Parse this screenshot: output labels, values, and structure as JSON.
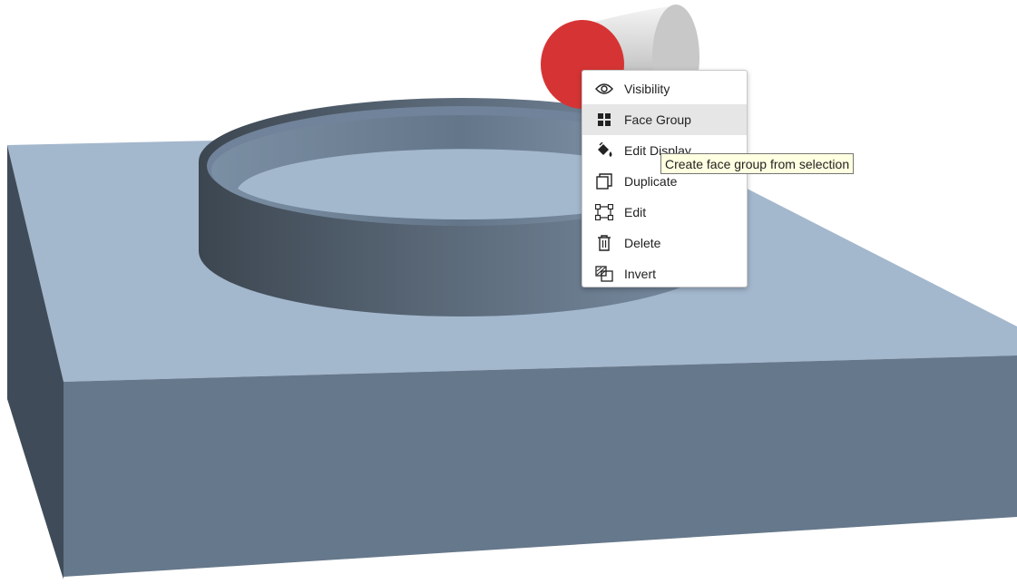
{
  "context_menu": {
    "items": [
      {
        "label": "Visibility",
        "icon": "eye-icon"
      },
      {
        "label": "Face Group",
        "icon": "grid-icon"
      },
      {
        "label": "Edit Display",
        "icon": "paint-bucket-icon"
      },
      {
        "label": "Duplicate",
        "icon": "duplicate-icon"
      },
      {
        "label": "Edit",
        "icon": "edit-frame-icon"
      },
      {
        "label": "Delete",
        "icon": "trash-icon"
      },
      {
        "label": "Invert",
        "icon": "invert-icon"
      }
    ],
    "hovered_item": "Face Group"
  },
  "tooltip": {
    "text": "Create face group from selection"
  },
  "colors": {
    "highlighted_face": "#d63434",
    "model_top": "#a3b7cd",
    "model_front": "#66788b",
    "model_side": "#3f4b58"
  }
}
